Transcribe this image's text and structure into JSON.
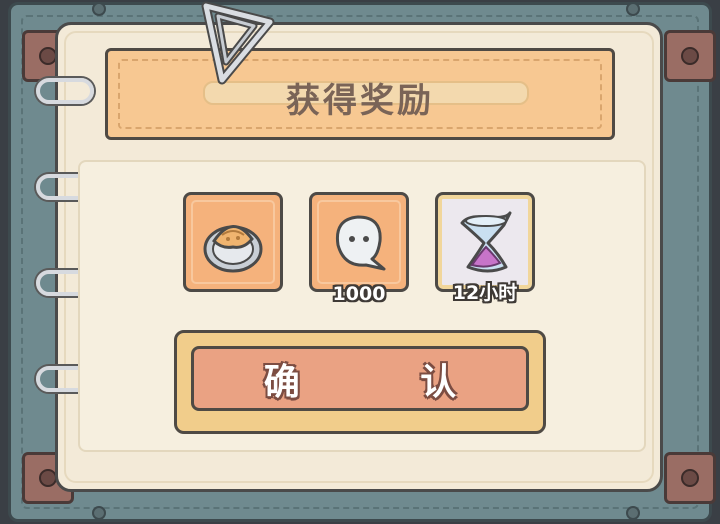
{
  "panel": {
    "title": "获得奖励"
  },
  "rewards": [
    {
      "icon": "pie-crate-icon",
      "count": ""
    },
    {
      "icon": "ghost-soul-icon",
      "count": "1000"
    },
    {
      "icon": "hourglass-icon",
      "count": "12小时"
    }
  ],
  "confirm": {
    "label": "确 认"
  },
  "colors": {
    "frame": "#6f8a8f",
    "paper": "#f3ead8",
    "banner": "#f7c892",
    "slot_orange": "#f5b27c",
    "button": "#eaa283"
  }
}
